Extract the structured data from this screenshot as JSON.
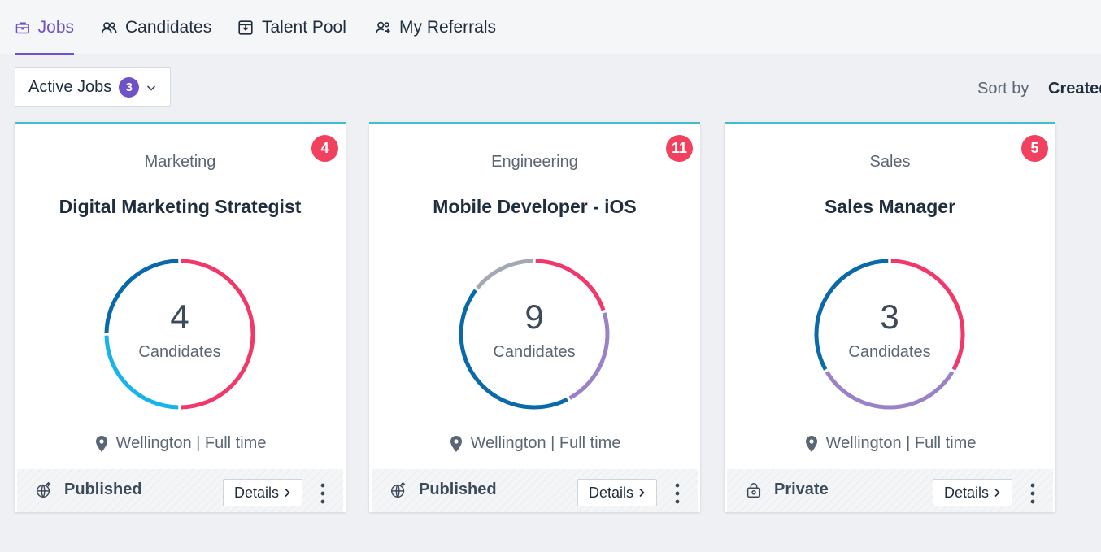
{
  "nav": {
    "tabs": [
      {
        "label": "Jobs",
        "icon": "briefcase-icon",
        "active": true
      },
      {
        "label": "Candidates",
        "icon": "users-icon",
        "active": false
      },
      {
        "label": "Talent Pool",
        "icon": "inbox-icon",
        "active": false
      },
      {
        "label": "My Referrals",
        "icon": "user-referral-icon",
        "active": false
      }
    ]
  },
  "filter": {
    "label": "Active Jobs",
    "count": "3"
  },
  "sort": {
    "label": "Sort by",
    "value": "Created"
  },
  "colors": {
    "accent": "#6f52c8",
    "card_top_border": "#3fbfca",
    "badge": "#f2405f",
    "segment_red": "#f0386b",
    "segment_blue": "#0a6aa9",
    "segment_cyan": "#17b3e9",
    "segment_purple": "#9a82c9",
    "segment_gray": "#a2a9b3"
  },
  "jobs": [
    {
      "department": "Marketing",
      "title": "Digital Marketing Strategist",
      "badge": "4",
      "candidates_count": "4",
      "candidates_label": "Candidates",
      "location": "Wellington | Full time",
      "status": "Published",
      "status_icon": "globe-icon",
      "details_label": "Details",
      "segments": [
        {
          "value": 2,
          "color": "#f0386b"
        },
        {
          "value": 1,
          "color": "#17b3e9"
        },
        {
          "value": 1,
          "color": "#0a6aa9"
        }
      ]
    },
    {
      "department": "Engineering",
      "title": "Mobile Developer - iOS",
      "badge": "11",
      "candidates_count": "9",
      "candidates_label": "Candidates",
      "location": "Wellington | Full time",
      "status": "Published",
      "status_icon": "globe-icon",
      "details_label": "Details",
      "segments": [
        {
          "value": 1.8,
          "color": "#f0386b"
        },
        {
          "value": 2.0,
          "color": "#9a82c9"
        },
        {
          "value": 3.9,
          "color": "#0a6aa9"
        },
        {
          "value": 1.3,
          "color": "#a2a9b3"
        }
      ]
    },
    {
      "department": "Sales",
      "title": "Sales Manager",
      "badge": "5",
      "candidates_count": "3",
      "candidates_label": "Candidates",
      "location": "Wellington | Full time",
      "status": "Private",
      "status_icon": "lock-icon",
      "details_label": "Details",
      "segments": [
        {
          "value": 1.0,
          "color": "#f0386b"
        },
        {
          "value": 1.0,
          "color": "#9a82c9"
        },
        {
          "value": 1.0,
          "color": "#0a6aa9"
        }
      ]
    }
  ]
}
